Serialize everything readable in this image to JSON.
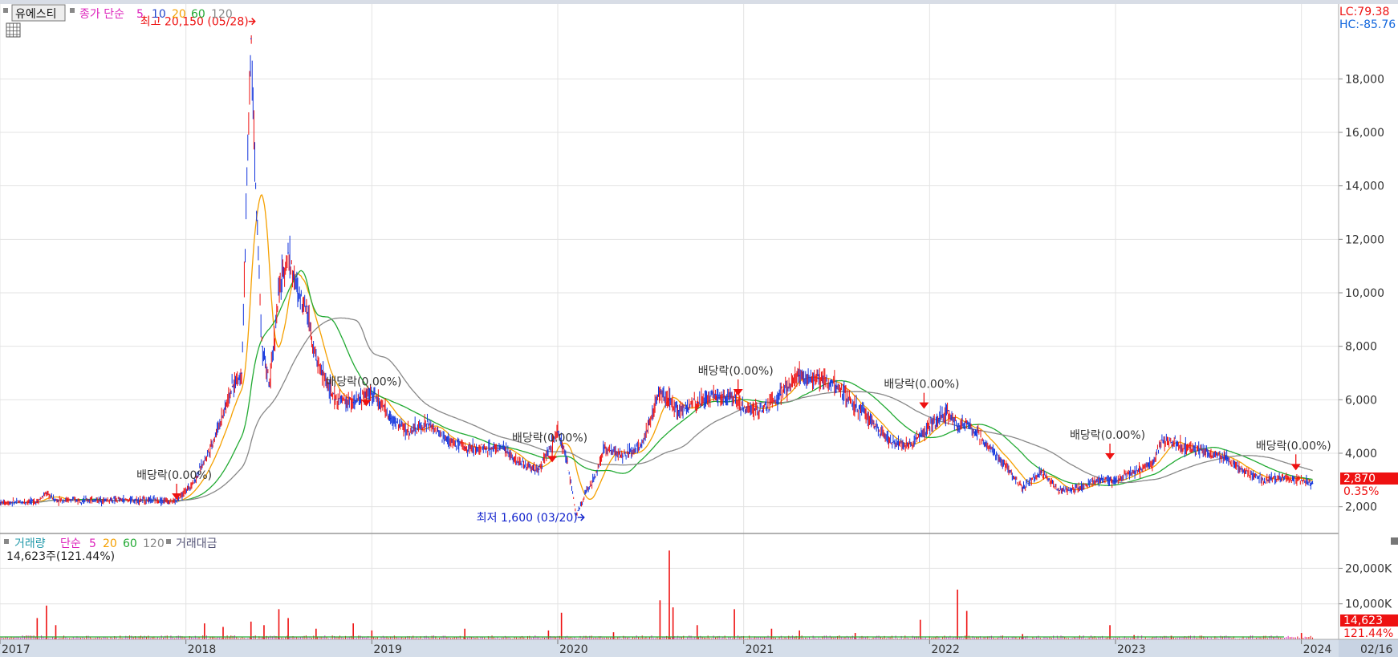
{
  "header": {
    "stock_name": "유에스티",
    "legend_prefix": "종가 단순",
    "ma_periods": [
      "5",
      "10",
      "20",
      "60",
      "120"
    ]
  },
  "volume_header": {
    "label": "거래량",
    "legend_prefix": "단순",
    "ma_periods": [
      "5",
      "20",
      "60",
      "120"
    ],
    "amount_label": "거래대금",
    "current_value": "14,623주(121.44%)"
  },
  "corner": {
    "lc": "LC:79.38",
    "hc": "HC:-85.76"
  },
  "price_badge": {
    "price": "2,870",
    "change": "0.35%"
  },
  "volume_badge": {
    "value": "14,623",
    "ratio": "121.44%"
  },
  "annotations": {
    "high": "최고 20,150 (05/28)",
    "low": "최저 1,600 (03/20)",
    "dividends": [
      {
        "label": "배당락(0.00%)",
        "t": 2017.95,
        "y": 2200
      },
      {
        "label": "배당락(0.00%)",
        "t": 2018.97,
        "y": 5700
      },
      {
        "label": "배당락(0.00%)",
        "t": 2019.97,
        "y": 3600
      },
      {
        "label": "배당락(0.00%)",
        "t": 2020.97,
        "y": 6100
      },
      {
        "label": "배당락(0.00%)",
        "t": 2021.97,
        "y": 5600
      },
      {
        "label": "배당락(0.00%)",
        "t": 2022.97,
        "y": 3700
      },
      {
        "label": "배당락(0.00%)",
        "t": 2023.97,
        "y": 3300
      }
    ]
  },
  "colors": {
    "candle_up": "#ee1111",
    "candle_down": "#1133dd",
    "ma5": "#dd22bb",
    "ma10": "#2244cc",
    "ma20": "#f5a000",
    "ma60": "#22aa33",
    "ma120": "#888888",
    "high_label": "#ee1111",
    "low_label": "#1122cc",
    "lc": "#ee1111",
    "hc": "#1166dd",
    "badge_bg": "#ee1111"
  },
  "chart_data": [
    {
      "type": "line",
      "panel": "price",
      "y_ticks": [
        "2,000",
        "4,000",
        "6,000",
        "8,000",
        "10,000",
        "12,000",
        "14,000",
        "16,000",
        "18,000"
      ],
      "ylim": [
        1000,
        20800
      ],
      "x_ticks": [
        "2017",
        "2018",
        "2019",
        "2020",
        "2021",
        "2022",
        "2023",
        "2024",
        "02/16"
      ],
      "x": [
        2017.0,
        2017.2,
        2017.25,
        2017.3,
        2017.5,
        2017.8,
        2017.95,
        2018.05,
        2018.15,
        2018.25,
        2018.3,
        2018.35,
        2018.38,
        2018.41,
        2018.45,
        2018.5,
        2018.55,
        2018.6,
        2018.65,
        2018.7,
        2018.8,
        2018.9,
        2019.0,
        2019.1,
        2019.2,
        2019.3,
        2019.4,
        2019.5,
        2019.6,
        2019.7,
        2019.8,
        2019.9,
        2020.0,
        2020.05,
        2020.1,
        2020.15,
        2020.2,
        2020.25,
        2020.35,
        2020.45,
        2020.55,
        2020.6,
        2020.65,
        2020.75,
        2020.85,
        2020.95,
        2021.0,
        2021.1,
        2021.2,
        2021.3,
        2021.4,
        2021.5,
        2021.6,
        2021.7,
        2021.8,
        2021.9,
        2022.0,
        2022.05,
        2022.1,
        2022.15,
        2022.2,
        2022.3,
        2022.4,
        2022.5,
        2022.6,
        2022.7,
        2022.8,
        2022.9,
        2023.0,
        2023.1,
        2023.2,
        2023.25,
        2023.3,
        2023.4,
        2023.5,
        2023.6,
        2023.7,
        2023.8,
        2023.9,
        2024.0,
        2024.06
      ],
      "series": [
        {
          "name": "",
          "values": [
            2150,
            2200,
            2500,
            2250,
            2250,
            2250,
            2200,
            3000,
            4500,
            6500,
            7000,
            19500,
            13000,
            8000,
            6500,
            10000,
            11500,
            10000,
            9500,
            7500,
            6000,
            5900,
            6300,
            5300,
            4800,
            5100,
            4500,
            4200,
            4200,
            4200,
            3600,
            3400,
            4800,
            3700,
            1700,
            2500,
            3100,
            4200,
            3900,
            4300,
            6300,
            6000,
            5600,
            5900,
            6200,
            6100,
            5700,
            5600,
            6200,
            6900,
            6800,
            6500,
            5800,
            5100,
            4400,
            4300,
            5000,
            5300,
            5600,
            5000,
            5100,
            4400,
            3600,
            2700,
            3300,
            2600,
            2700,
            3000,
            3000,
            3300,
            3600,
            4500,
            4400,
            4200,
            4000,
            3800,
            3300,
            3000,
            3100,
            3000,
            2870
          ]
        }
      ]
    },
    {
      "type": "bar",
      "panel": "volume",
      "y_ticks": [
        "10,000K",
        "20,000K"
      ],
      "ylim": [
        0,
        28000
      ],
      "x": [
        2017.2,
        2017.25,
        2017.3,
        2018.1,
        2018.2,
        2018.35,
        2018.42,
        2018.5,
        2018.55,
        2018.7,
        2018.9,
        2019.0,
        2019.5,
        2019.95,
        2020.02,
        2020.3,
        2020.55,
        2020.6,
        2020.62,
        2020.75,
        2020.95,
        2021.15,
        2021.3,
        2021.6,
        2021.95,
        2022.15,
        2022.2,
        2022.5,
        2022.97,
        2023.1,
        2023.3,
        2024.0
      ],
      "values": [
        6000,
        9500,
        4000,
        4500,
        3500,
        5000,
        4000,
        8500,
        6000,
        3000,
        4500,
        2500,
        3000,
        2500,
        7500,
        2000,
        11000,
        25000,
        9000,
        4000,
        8500,
        3000,
        2500,
        1800,
        5500,
        14000,
        8000,
        1500,
        4000,
        1200,
        1000,
        1800
      ]
    }
  ]
}
